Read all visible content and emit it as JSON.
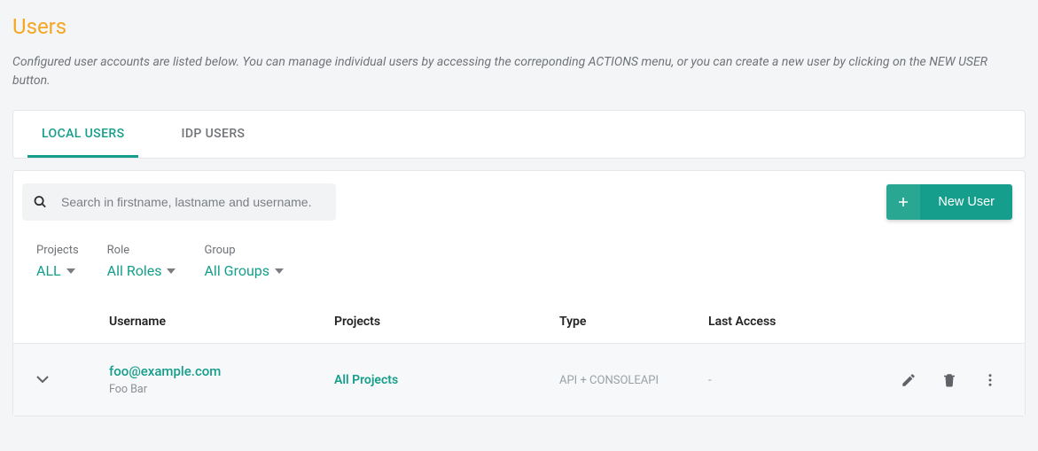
{
  "page": {
    "title": "Users",
    "description": "Configured user accounts are listed below. You can manage individual users by accessing the correponding ACTIONS menu, or you can create a new user by clicking on the NEW USER button."
  },
  "tabs": [
    {
      "label": "LOCAL USERS",
      "active": true
    },
    {
      "label": "IDP USERS",
      "active": false
    }
  ],
  "search": {
    "placeholder": "Search in firstname, lastname and username."
  },
  "buttons": {
    "new_user": "New User"
  },
  "filters": {
    "projects": {
      "label": "Projects",
      "value": "ALL"
    },
    "role": {
      "label": "Role",
      "value": "All Roles"
    },
    "group": {
      "label": "Group",
      "value": "All Groups"
    }
  },
  "columns": {
    "username": "Username",
    "projects": "Projects",
    "type": "Type",
    "last_access": "Last Access"
  },
  "rows": [
    {
      "username": "foo@example.com",
      "full_name": "Foo Bar",
      "projects": "All Projects",
      "type": "API + CONSOLEAPI",
      "last_access": "-"
    }
  ]
}
